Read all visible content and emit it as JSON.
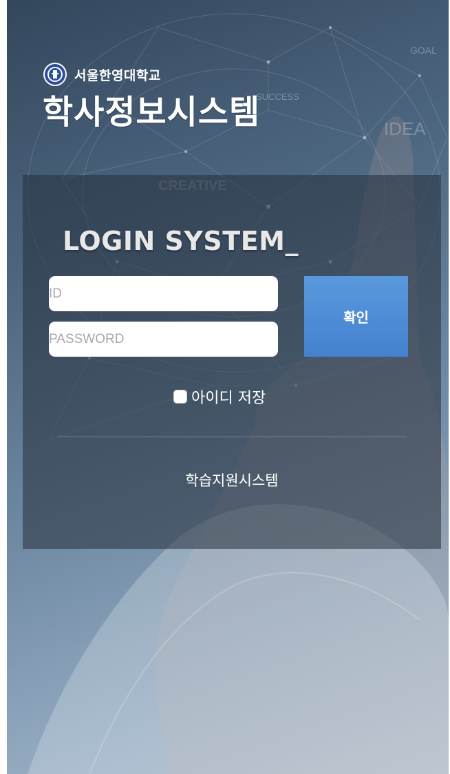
{
  "header": {
    "university_name": "서울한영대학교",
    "app_title": "학사정보시스템",
    "seal_icon": "university-seal-icon"
  },
  "background_words": [
    "GOAL",
    "SUCCESS",
    "IDEA",
    "CREATIVE"
  ],
  "login": {
    "heading": "LOGIN SYSTEM_",
    "id_placeholder": "ID",
    "password_placeholder": "PASSWORD",
    "confirm_label": "확인",
    "save_id_label": "아이디 저장"
  },
  "footer_link": {
    "label": "학습지원시스템"
  },
  "colors": {
    "confirm_button": "#4a8ad6",
    "panel_overlay": "#26303c"
  }
}
